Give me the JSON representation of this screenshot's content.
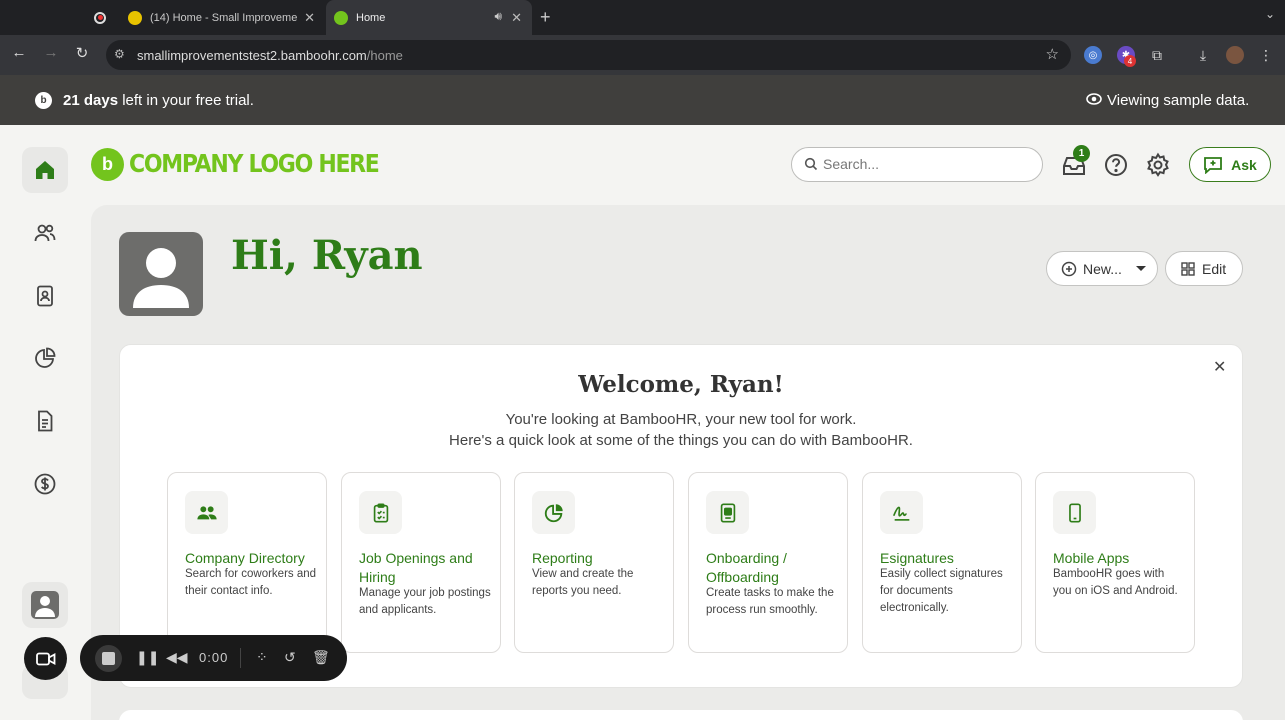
{
  "browser": {
    "tabs": [
      {
        "label": "(14) Home - Small Improveme",
        "active": false
      },
      {
        "label": "Home",
        "active": true
      }
    ],
    "url_host": "smallimprovementstest2.bamboohr.com",
    "url_path": "/home",
    "extension_badge": "4"
  },
  "trial_banner": {
    "days_bold": "21 days",
    "days_rest": " left in your free trial.",
    "sample_text": "Viewing sample data."
  },
  "header": {
    "logo_mark": "b",
    "logo_text": "COMPANY LOGO HERE",
    "search_placeholder": "Search...",
    "inbox_badge": "1",
    "ask_label": "Ask"
  },
  "sidebar": {
    "items": [
      {
        "icon": "home-icon",
        "active": true
      },
      {
        "icon": "people-icon",
        "active": false
      },
      {
        "icon": "id-badge-icon",
        "active": false
      },
      {
        "icon": "pie-chart-icon",
        "active": false
      },
      {
        "icon": "document-icon",
        "active": false
      },
      {
        "icon": "dollar-icon",
        "active": false
      }
    ]
  },
  "greeting": {
    "text": "Hi, Ryan",
    "new_label": "New...",
    "edit_label": "Edit"
  },
  "welcome": {
    "title": "Welcome, Ryan!",
    "line1": "You're looking at BambooHR, your new tool for work.",
    "line2": "Here's a quick look at some of the things you can do with BambooHR.",
    "close": "✕",
    "features": [
      {
        "icon": "people-icon",
        "title": "Company Directory",
        "desc": "Search for coworkers and their contact info."
      },
      {
        "icon": "clipboard-icon",
        "title": "Job Openings and Hiring",
        "desc": "Manage your job postings and applicants."
      },
      {
        "icon": "pie-chart-icon",
        "title": "Reporting",
        "desc": "View and create the reports you need."
      },
      {
        "icon": "id-badge-icon",
        "title": "Onboarding / Offboarding",
        "desc": "Create tasks to make the process run smoothly."
      },
      {
        "icon": "signature-icon",
        "title": "Esignatures",
        "desc": "Easily collect signatures for documents electronically."
      },
      {
        "icon": "phone-icon",
        "title": "Mobile Apps",
        "desc": "BambooHR goes with you on iOS and Android."
      }
    ]
  },
  "recorder": {
    "time": "0:00"
  },
  "colors": {
    "brand_green": "#73c41d",
    "text_green": "#2e7d18",
    "banner_bg": "#403f3d"
  }
}
